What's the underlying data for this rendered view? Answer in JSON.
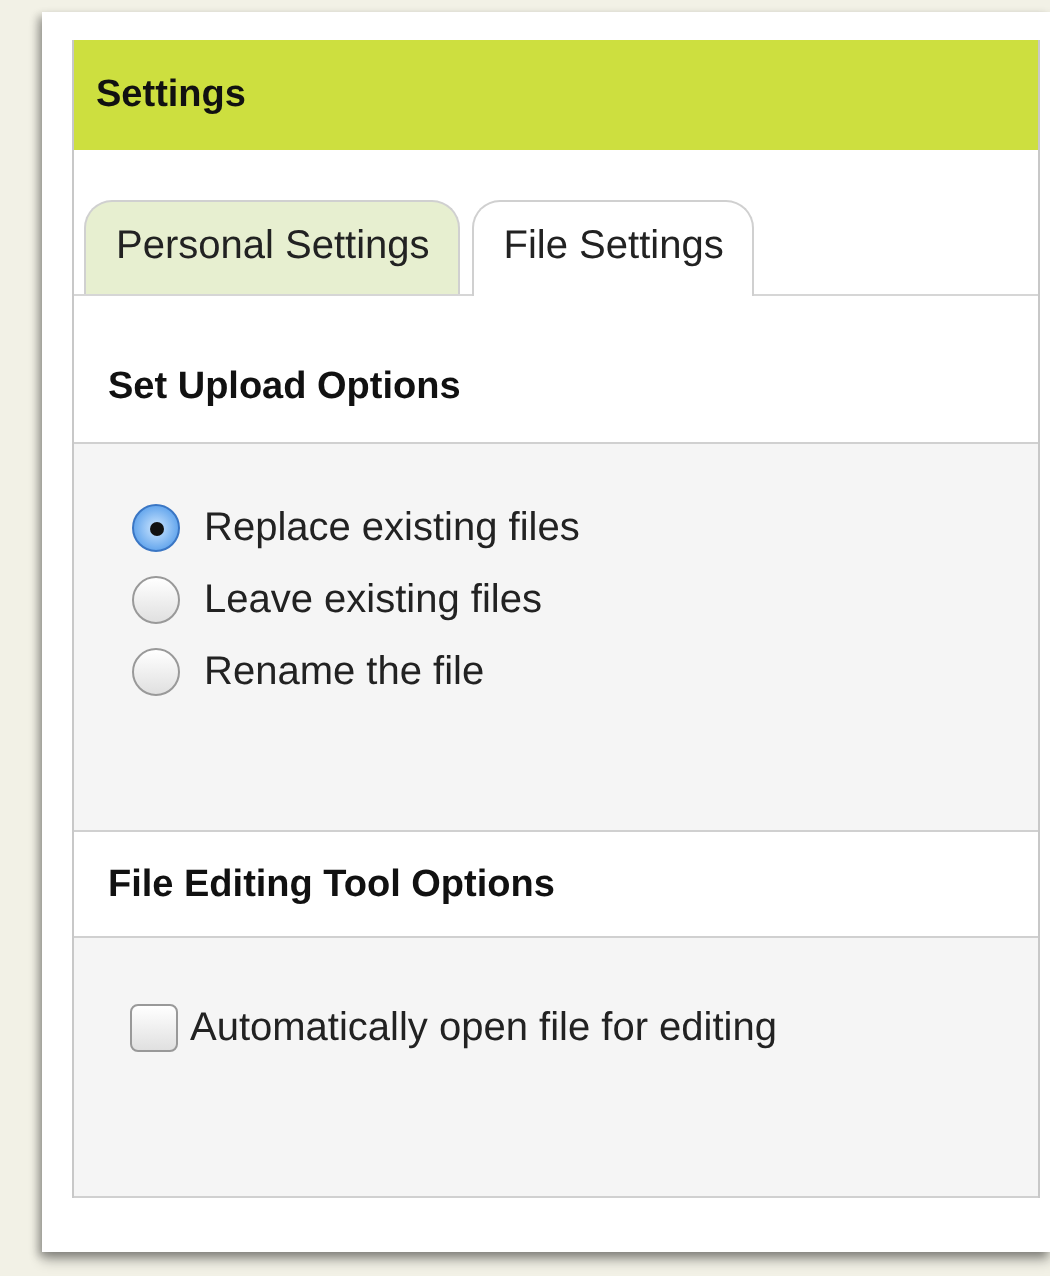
{
  "panel": {
    "title": "Settings"
  },
  "tabs": [
    {
      "label": "Personal Settings",
      "selected": false
    },
    {
      "label": "File Settings",
      "selected": true
    }
  ],
  "sections": [
    {
      "heading": "Set Upload Options",
      "options": [
        {
          "kind": "radio",
          "label": "Replace existing files",
          "selected": true
        },
        {
          "kind": "radio",
          "label": "Leave existing files",
          "selected": false
        },
        {
          "kind": "radio",
          "label": "Rename the file",
          "selected": false
        }
      ]
    },
    {
      "heading": "File Editing Tool Options",
      "options": [
        {
          "kind": "checkbox",
          "label": "Automatically open file for editing",
          "checked": false
        }
      ]
    }
  ]
}
